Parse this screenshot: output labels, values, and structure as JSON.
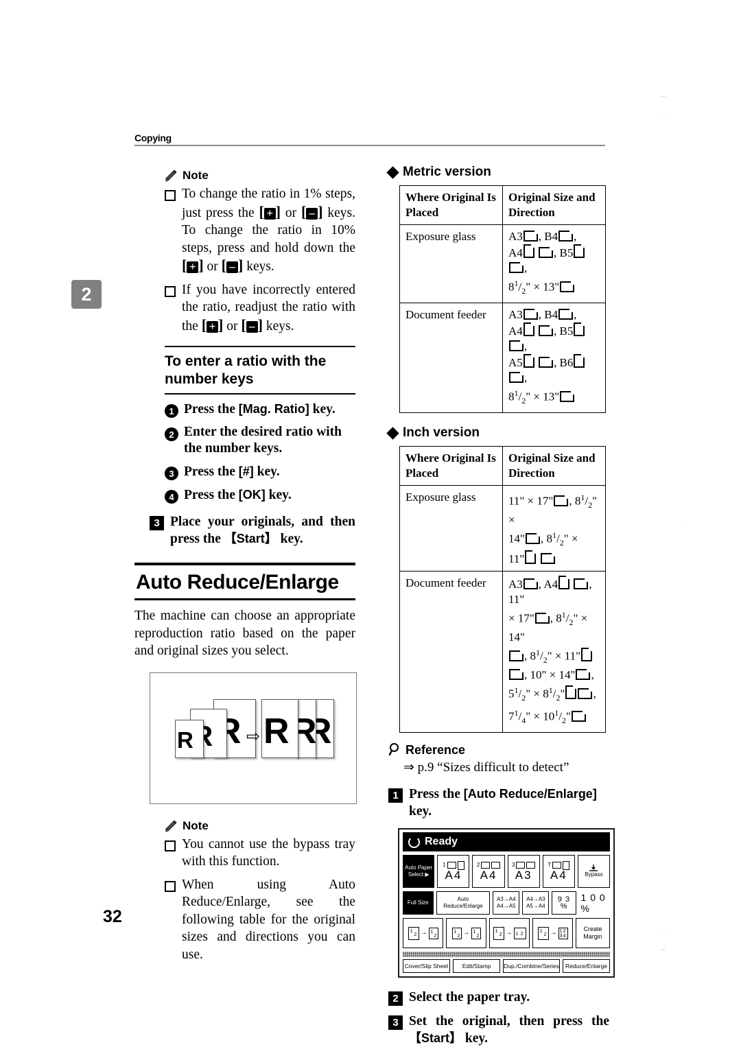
{
  "header": {
    "running_head": "Copying",
    "chapter_tab": "2",
    "page_number": "32"
  },
  "left": {
    "note1": {
      "icon": "pencil-icon",
      "label": "Note",
      "items": [
        "To change the ratio in 1% steps, just press the [+] or [–] keys. To change the ratio in 10% steps, press and hold down the [+] or [–] keys.",
        "If you have incorrectly entered the ratio, readjust the ratio with the [+] or [–] keys."
      ]
    },
    "subsection": {
      "title": "To enter a ratio with the number keys"
    },
    "circle_steps": [
      {
        "num": "1",
        "text": "Press the [Mag. Ratio] key."
      },
      {
        "num": "2",
        "text": "Enter the desired ratio with the number keys."
      },
      {
        "num": "3",
        "text": "Press the [#] key."
      },
      {
        "num": "4",
        "text": "Press the [OK] key."
      }
    ],
    "step3": {
      "num": "3",
      "text": "Place your originals, and then press the 【Start】 key."
    },
    "section": {
      "title": "Auto Reduce/Enlarge"
    },
    "intro": "The machine can choose an appropriate reproduction ratio based on the paper and original sizes you select.",
    "figure": {
      "name": "auto-reduce-enlarge-illustration",
      "left_glyphs": [
        "R",
        "R",
        "R"
      ],
      "arrow": "⇨",
      "right_glyphs": [
        "R",
        "R",
        "R"
      ]
    },
    "note2": {
      "icon": "pencil-icon",
      "label": "Note",
      "items": [
        "You cannot use the bypass tray with this function.",
        "When using Auto Reduce/Enlarge, see the following table for the original sizes and directions you can use."
      ]
    }
  },
  "right": {
    "metric": {
      "heading": "Metric version",
      "columns": [
        "Where Original Is Placed",
        "Original Size and Direction"
      ],
      "rows": [
        {
          "where": "Exposure glass",
          "sizes": "A3▭, B4▭, A4▯▭, B5▯▭, 8 1/2\" × 13\"▭"
        },
        {
          "where": "Document feeder",
          "sizes": "A3▭, B4▭, A4▯▭, B5▯▭, A5▯▭, B6▯▭, 8 1/2\" × 13\"▭"
        }
      ]
    },
    "inch": {
      "heading": "Inch version",
      "columns": [
        "Where Original Is Placed",
        "Original Size and Direction"
      ],
      "rows": [
        {
          "where": "Exposure glass",
          "sizes": "11\" × 17\"▭, 8 1/2\" × 14\"▭, 8 1/2\" × 11\"▯▭"
        },
        {
          "where": "Document feeder",
          "sizes": "A3▭, A4▯▭, 11\" × 17\"▭, 8 1/2\" × 14\"▭, 8 1/2\" × 11\"▯▭, 10\" × 14\"▭, 5 1/2\" × 8 1/2\"▯▭, 7 1/4\" × 10 1/2\"▭"
        }
      ]
    },
    "reference": {
      "icon": "magnifier-icon",
      "label": "Reference",
      "text": "⇒ p.9 “Sizes difficult to detect”"
    },
    "step1": {
      "num": "1",
      "text": "Press the [Auto Reduce/Enlarge] key."
    },
    "step2": {
      "num": "2",
      "text": "Select the paper tray."
    },
    "step3": {
      "num": "3",
      "text": "Set the original, then press the 【Start】 key."
    },
    "lcd": {
      "status": "Ready",
      "trays": [
        {
          "id": "auto",
          "line1": "Auto Paper",
          "line2": "Select ▶",
          "selected": true
        },
        {
          "id": "tray1",
          "num": "1",
          "size": "A4",
          "orient": "portrait"
        },
        {
          "id": "tray2",
          "num": "2",
          "size": "A4",
          "orient": "landscape"
        },
        {
          "id": "tray3",
          "num": "3",
          "size": "A3",
          "orient": "landscape"
        },
        {
          "id": "trayT",
          "num": "T",
          "size": "A4",
          "orient": "portrait"
        },
        {
          "id": "bypass",
          "label": "Bypass"
        }
      ],
      "ratio_row": {
        "full_size": "Full Size",
        "auto_reduce": "Auto Reduce/Enlarge",
        "preset1": [
          "A3→A4",
          "A4→A5"
        ],
        "preset2": [
          "A4→A3",
          "A5→A4"
        ],
        "preset3": "9 3 %",
        "current": "1 0 0 %"
      },
      "duplex_row": {
        "buttons": [
          "1 2 → 1/2",
          "1/2 → 1/2",
          "1 2 → 1 2",
          "1 2 → 1 2 3 4"
        ],
        "create_margin": [
          "Create",
          "Margin"
        ]
      },
      "tabs": [
        "Cover/Slip Sheet",
        "Edit/Stamp",
        "Dup./Combine/Series",
        "Reduce/Enlarge"
      ]
    }
  }
}
